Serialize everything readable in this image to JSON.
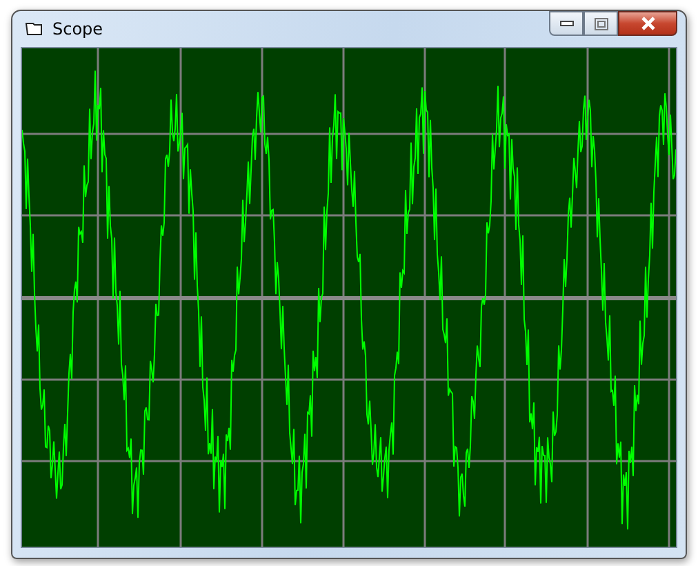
{
  "window": {
    "title": "Scope"
  }
}
